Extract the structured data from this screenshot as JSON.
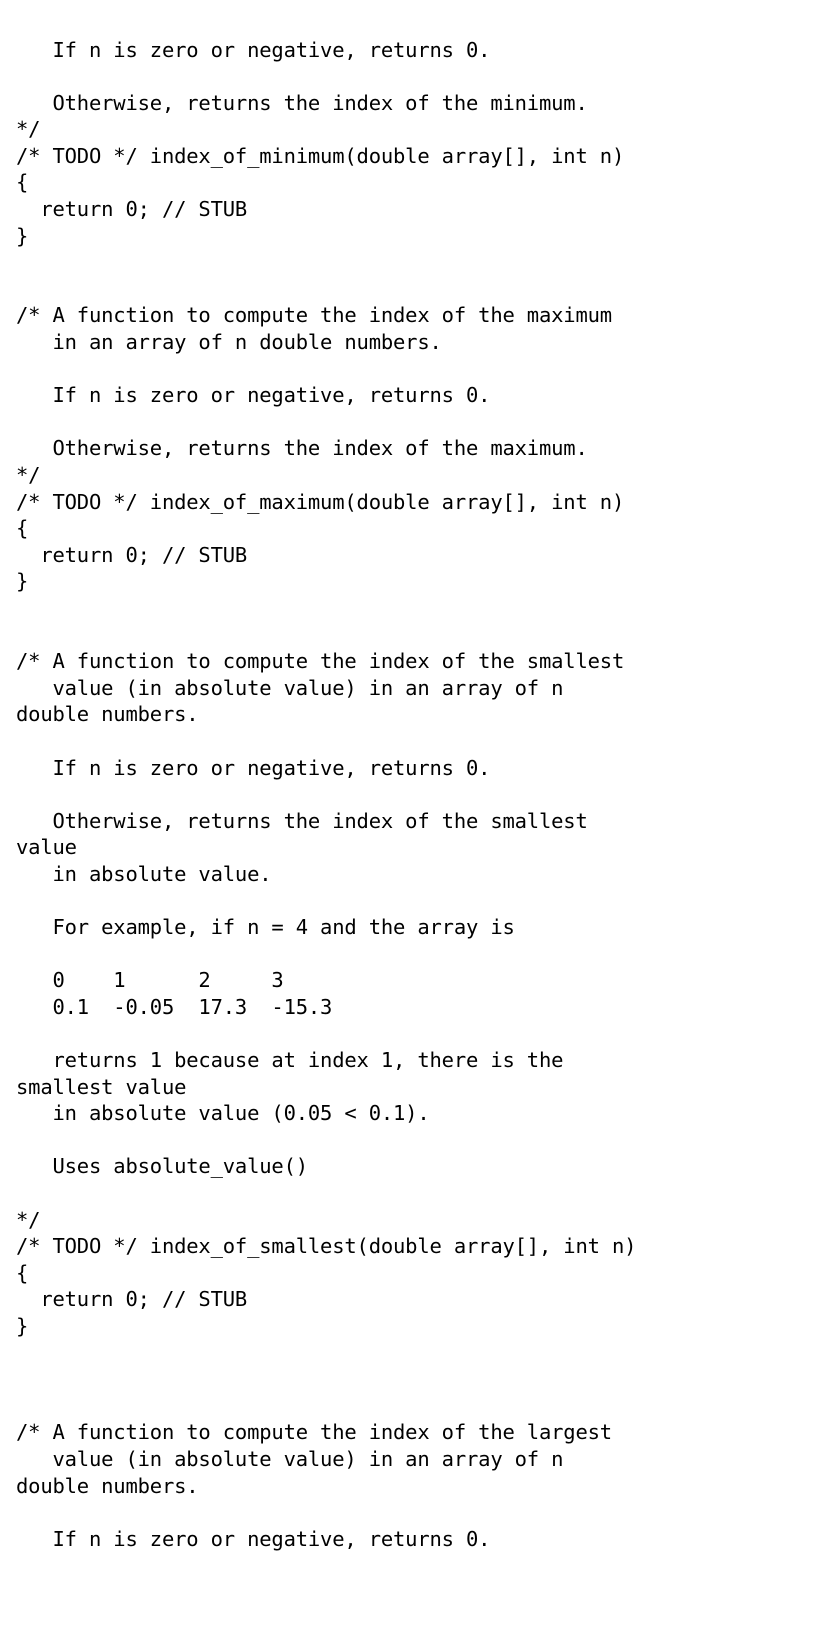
{
  "document": {
    "kind": "c-source-code",
    "language": "C",
    "background_color": "#ffffff",
    "text_color": "#000000"
  },
  "code": {
    "lines": [
      "   If n is zero or negative, returns 0.",
      "",
      "   Otherwise, returns the index of the minimum.",
      "*/",
      "/* TODO */ index_of_minimum(double array[], int n)",
      "{",
      "  return 0; // STUB",
      "}",
      "",
      "",
      "/* A function to compute the index of the maximum",
      "   in an array of n double numbers.",
      "",
      "   If n is zero or negative, returns 0.",
      "",
      "   Otherwise, returns the index of the maximum.",
      "*/",
      "/* TODO */ index_of_maximum(double array[], int n)",
      "{",
      "  return 0; // STUB",
      "}",
      "",
      "",
      "/* A function to compute the index of the smallest",
      "   value (in absolute value) in an array of n",
      "double numbers.",
      "",
      "   If n is zero or negative, returns 0.",
      "",
      "   Otherwise, returns the index of the smallest",
      "value",
      "   in absolute value.",
      "",
      "   For example, if n = 4 and the array is",
      "",
      "   0    1      2     3",
      "   0.1  -0.05  17.3  -15.3",
      "",
      "   returns 1 because at index 1, there is the",
      "smallest value",
      "   in absolute value (0.05 < 0.1).",
      "",
      "   Uses absolute_value()",
      "",
      "*/",
      "/* TODO */ index_of_smallest(double array[], int n)",
      "{",
      "  return 0; // STUB",
      "}",
      "",
      "",
      "",
      "/* A function to compute the index of the largest",
      "   value (in absolute value) in an array of n",
      "double numbers.",
      "",
      "   If n is zero or negative, returns 0."
    ]
  },
  "example_table": {
    "indices": [
      "0",
      "1",
      "2",
      "3"
    ],
    "values": [
      "0.1",
      "-0.05",
      "17.3",
      "-15.3"
    ],
    "n": "4",
    "answer_index": "1",
    "comparison": "0.05 < 0.1"
  },
  "functions": [
    {
      "name": "index_of_minimum",
      "signature": "/* TODO */ index_of_minimum(double array[], int n)",
      "body": "  return 0; // STUB"
    },
    {
      "name": "index_of_maximum",
      "signature": "/* TODO */ index_of_maximum(double array[], int n)",
      "body": "  return 0; // STUB"
    },
    {
      "name": "index_of_smallest",
      "signature": "/* TODO */ index_of_smallest(double array[], int n)",
      "body": "  return 0; // STUB"
    }
  ]
}
